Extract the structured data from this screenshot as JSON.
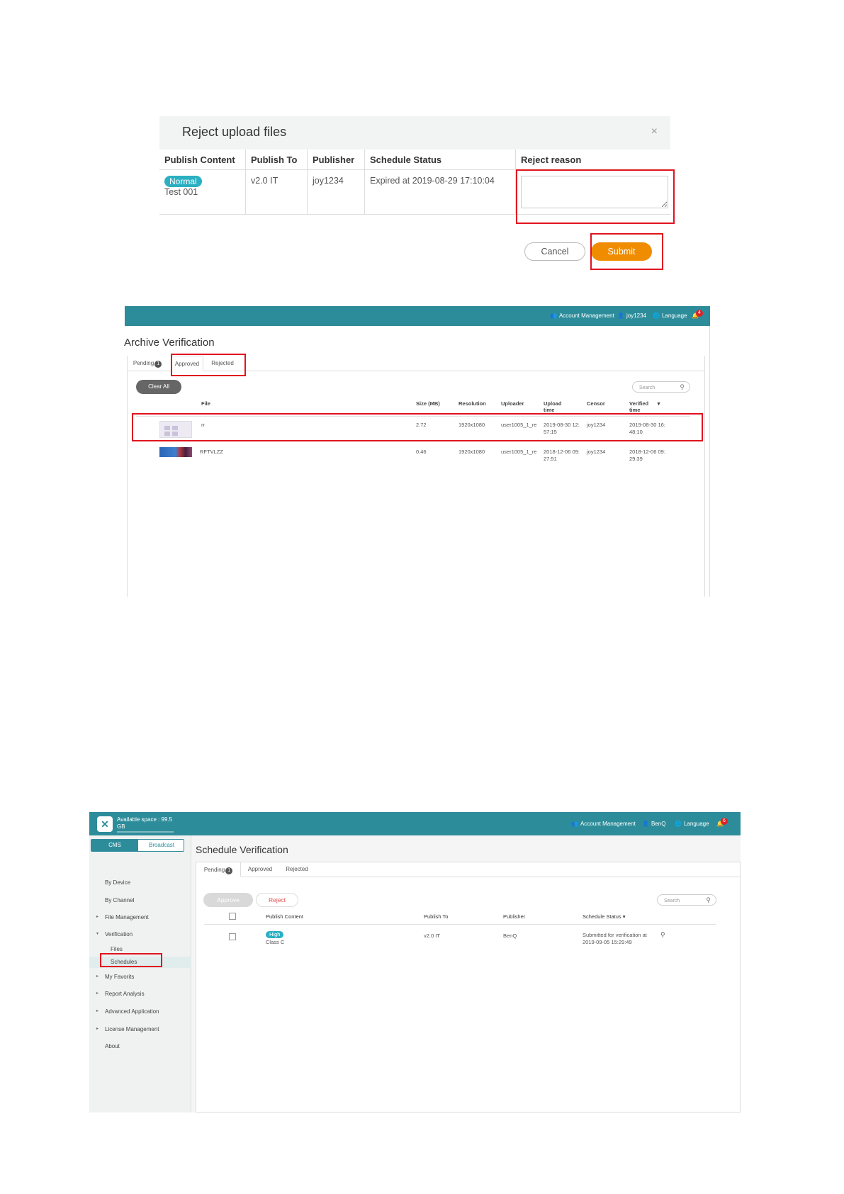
{
  "reject_dialog": {
    "title": "Reject upload files",
    "close": "×",
    "headers": [
      "Publish Content",
      "Publish To",
      "Publisher",
      "Schedule Status",
      "Reject reason"
    ],
    "row": {
      "badge": "Normal",
      "content": "Test 001",
      "publish_to": "v2.0 IT",
      "publisher": "joy1234",
      "status": "Expired at 2019-08-29 17:10:04"
    },
    "cancel_label": "Cancel",
    "submit_label": "Submit",
    "colors": {
      "accent": "#2bb0c2",
      "submit": "#f08c00",
      "highlight": "#e0141e"
    }
  },
  "archive": {
    "topbar": {
      "account_management": "Account Management",
      "user": "joy1234",
      "language": "Language",
      "notifications": "4"
    },
    "title": "Archive Verification",
    "tabs": {
      "pending": "Pending",
      "pending_count": "1",
      "approved": "Approved",
      "rejected": "Rejected"
    },
    "clear_all": "Clear All",
    "search_placeholder": "Search",
    "columns": {
      "file": "File",
      "size": "Size (MB)",
      "resolution": "Resolution",
      "uploader": "Uploader",
      "upload_time_1": "Upload",
      "upload_time_2": "time",
      "censor": "Censor",
      "verified_1": "Verified",
      "verified_2": "time"
    },
    "rows": [
      {
        "file": "rr",
        "size": "2.72",
        "resolution": "1920x1080",
        "uploader": "user1005_1_re",
        "upload_1": "2019-08-30 12:",
        "upload_2": "57:15",
        "censor": "joy1234",
        "verified_1": "2019-08-30 16:",
        "verified_2": "48:10"
      },
      {
        "file": "RFTVLZZ",
        "size": "0.46",
        "resolution": "1920x1080",
        "uploader": "user1005_1_re",
        "upload_1": "2018-12-06 09:",
        "upload_2": "27:51",
        "censor": "joy1234",
        "verified_1": "2018-12-06 09:",
        "verified_2": "29:39"
      }
    ],
    "colors": {
      "topbar": "#2d8c9a"
    }
  },
  "schedule": {
    "topbar": {
      "space_1": "Available space : 99.5",
      "space_2": "GB",
      "account_management": "Account Management",
      "user": "BenQ",
      "language": "Language",
      "notifications": "6"
    },
    "segment": {
      "cms": "CMS",
      "broadcast": "Broadcast"
    },
    "nav": {
      "by_device": "By Device",
      "by_channel": "By Channel",
      "file_management": "File Management",
      "verification": "Verification",
      "files": "Files",
      "schedules": "Schedules",
      "my_favorits": "My Favorits",
      "report_analysis": "Report Analysis",
      "advanced_application": "Advanced Application",
      "license_management": "License Management",
      "about": "About"
    },
    "title": "Schedule Verification",
    "tabs": {
      "pending": "Pending",
      "pending_count": "1",
      "approved": "Approved",
      "rejected": "Rejected"
    },
    "approve_label": "Approve",
    "reject_label": "Reject",
    "search_placeholder": "Search",
    "columns": {
      "publish_content": "Publish Content",
      "publish_to": "Publish To",
      "publisher": "Publisher",
      "schedule_status": "Schedule Status"
    },
    "row": {
      "badge": "High",
      "content": "Class C",
      "publish_to": "v2.0 IT",
      "publisher": "BenQ",
      "status_1": "Submitted for verification at",
      "status_2": "2019-09-05 15:29:49"
    }
  }
}
